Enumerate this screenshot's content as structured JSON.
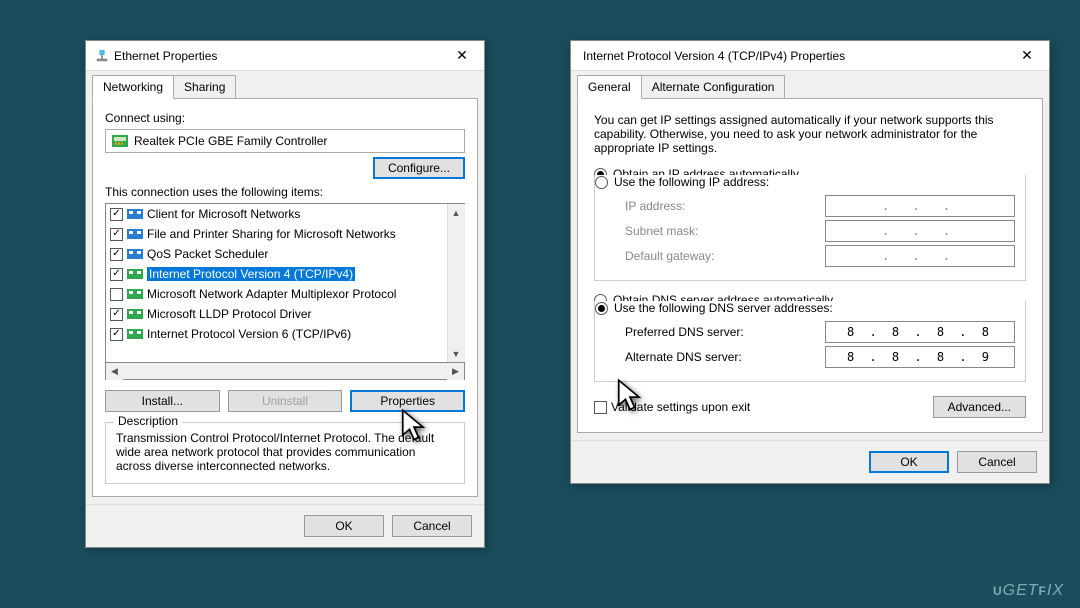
{
  "watermark": "UGETFIX",
  "ethernet": {
    "title": "Ethernet Properties",
    "tabs": {
      "networking": "Networking",
      "sharing": "Sharing"
    },
    "connect_using_label": "Connect using:",
    "adapter": "Realtek PCIe GBE Family Controller",
    "configure_btn": "Configure...",
    "items_label": "This connection uses the following items:",
    "items": [
      {
        "label": "Client for Microsoft Networks",
        "checked": true,
        "selected": false,
        "iconColor": "#2b7cd3"
      },
      {
        "label": "File and Printer Sharing for Microsoft Networks",
        "checked": true,
        "selected": false,
        "iconColor": "#2b7cd3"
      },
      {
        "label": "QoS Packet Scheduler",
        "checked": true,
        "selected": false,
        "iconColor": "#2b7cd3"
      },
      {
        "label": "Internet Protocol Version 4 (TCP/IPv4)",
        "checked": true,
        "selected": true,
        "iconColor": "#2fa84f"
      },
      {
        "label": "Microsoft Network Adapter Multiplexor Protocol",
        "checked": false,
        "selected": false,
        "iconColor": "#2fa84f"
      },
      {
        "label": "Microsoft LLDP Protocol Driver",
        "checked": true,
        "selected": false,
        "iconColor": "#2fa84f"
      },
      {
        "label": "Internet Protocol Version 6 (TCP/IPv6)",
        "checked": true,
        "selected": false,
        "iconColor": "#2fa84f"
      }
    ],
    "install_btn": "Install...",
    "uninstall_btn": "Uninstall",
    "properties_btn": "Properties",
    "desc_title": "Description",
    "description": "Transmission Control Protocol/Internet Protocol. The default wide area network protocol that provides communication across diverse interconnected networks.",
    "ok": "OK",
    "cancel": "Cancel"
  },
  "ipv4": {
    "title": "Internet Protocol Version 4 (TCP/IPv4) Properties",
    "tabs": {
      "general": "General",
      "alt": "Alternate Configuration"
    },
    "blurb": "You can get IP settings assigned automatically if your network supports this capability. Otherwise, you need to ask your network administrator for the appropriate IP settings.",
    "ip_auto": "Obtain an IP address automatically",
    "ip_manual": "Use the following IP address:",
    "ip_address_lbl": "IP address:",
    "subnet_lbl": "Subnet mask:",
    "gateway_lbl": "Default gateway:",
    "dns_auto": "Obtain DNS server address automatically",
    "dns_manual": "Use the following DNS server addresses:",
    "pref_dns_lbl": "Preferred DNS server:",
    "alt_dns_lbl": "Alternate DNS server:",
    "pref_dns": "8 . 8 . 8 . 8",
    "alt_dns": "8 . 8 . 8 . 9",
    "dots": ".   .   .",
    "validate": "Validate settings upon exit",
    "advanced": "Advanced...",
    "ok": "OK",
    "cancel": "Cancel"
  }
}
